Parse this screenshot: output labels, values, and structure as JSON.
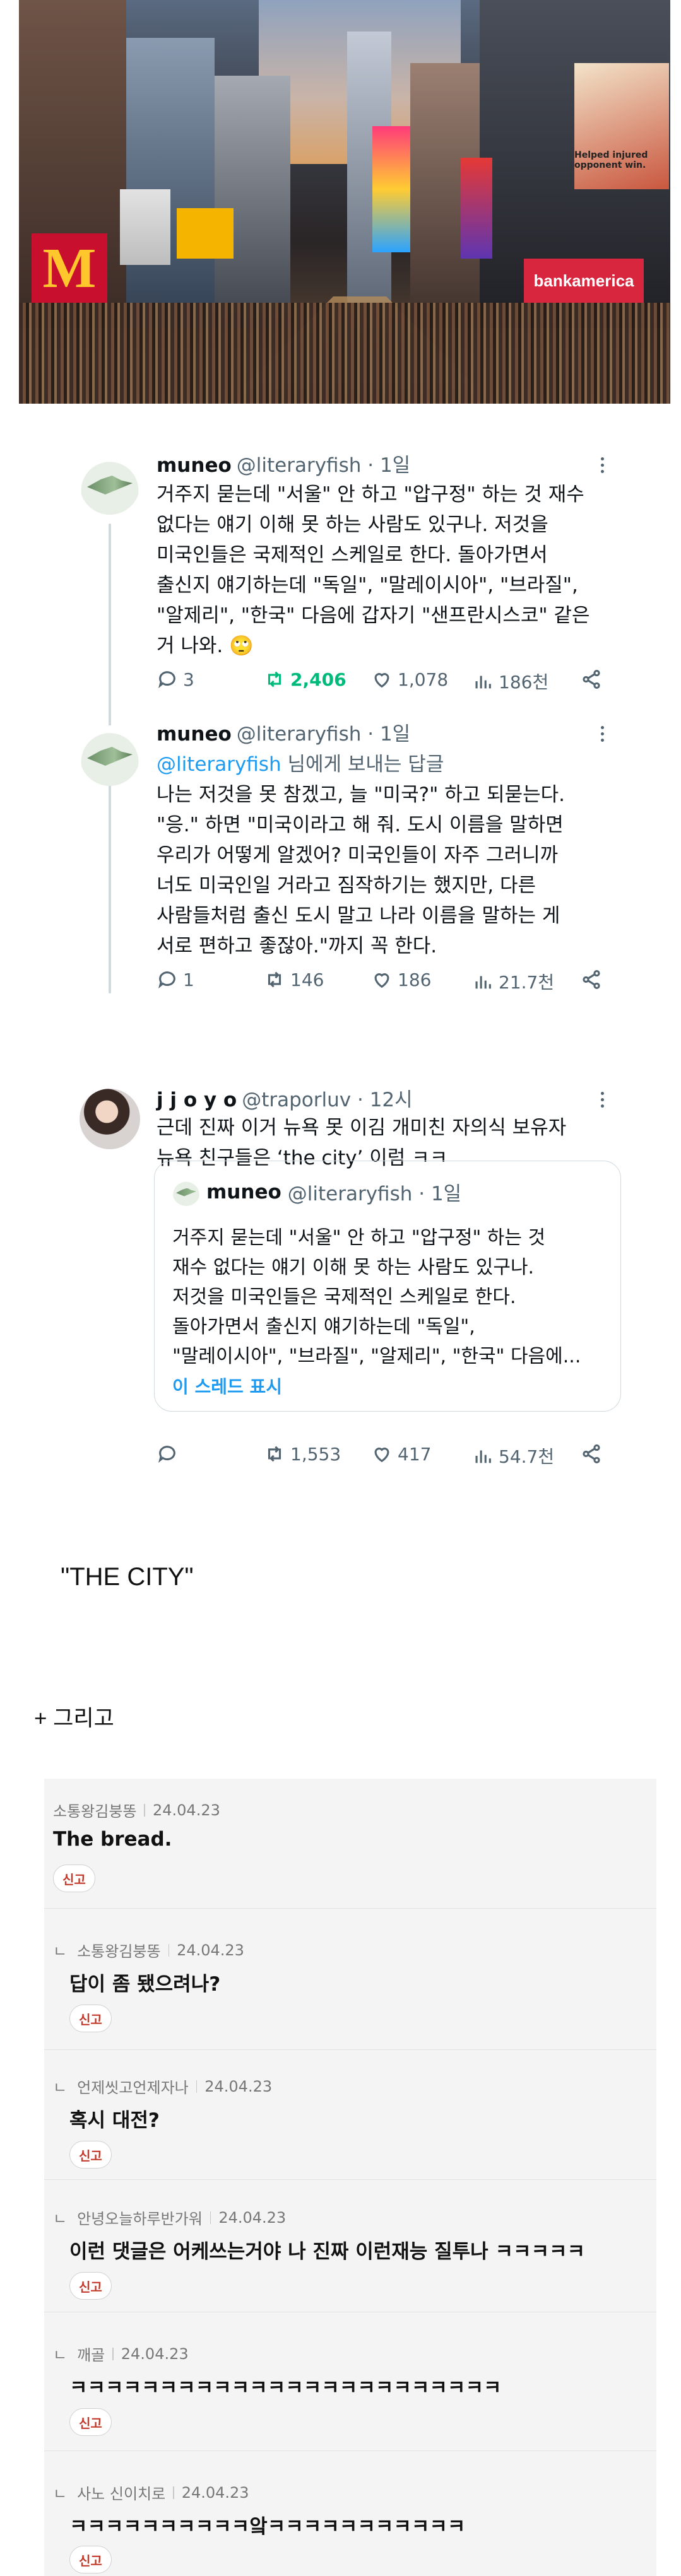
{
  "photo": {
    "mcdonalds_sign": "M",
    "store_sign": "bankamerica",
    "ad_text": "Helped injured opponent win."
  },
  "tweet1": {
    "name": "muneo",
    "handle": "@literaryfish · 1일",
    "text": "거주지 묻는데 \"서울\" 안 하고 \"압구정\" 하는 것 재수\n없다는 얘기 이해 못 하는 사람도 있구나. 저것을\n미국인들은 국제적인 스케일로 한다. 돌아가면서\n출신지 얘기하는데 \"독일\", \"말레이시아\", \"브라질\",\n\"알제리\", \"한국\" 다음에 갑자기 \"샌프란시스코\" 같은\n거 나와. 🙄",
    "replies": "3",
    "retweets": "2,406",
    "likes": "1,078",
    "views": "186천"
  },
  "tweet2": {
    "name": "muneo",
    "handle": "@literaryfish · 1일",
    "reply_mention": "@literaryfish",
    "reply_suffix": " 님에게 보내는 답글",
    "text": "나는 저것을 못 참겠고, 늘 \"미국?\" 하고 되묻는다.\n\"응.\" 하면 \"미국이라고 해 줘. 도시 이름을 말하면\n우리가 어떻게 알겠어? 미국인들이 자주 그러니까\n너도 미국인일 거라고 짐작하기는 했지만, 다른\n사람들처럼 출신 도시 말고 나라 이름을 말하는 게\n서로 편하고 좋잖아.\"까지 꼭 한다.",
    "replies": "1",
    "retweets": "146",
    "likes": "186",
    "views": "21.7천"
  },
  "tweet3": {
    "name": "j j o y o",
    "handle": "@traporluv · 12시",
    "text": "근데 진짜 이거 뉴욕 못 이김 개미친 자의식 보유자\n뉴욕 친구들은 ‘the city’ 이럼 ㅋㅋ",
    "quote": {
      "name": "muneo",
      "handle": "@literaryfish · 1일",
      "text": "거주지 묻는데 \"서울\" 안 하고 \"압구정\" 하는 것\n재수 없다는 얘기 이해 못 하는 사람도 있구나.\n저것을 미국인들은 국제적인 스케일로 한다.\n돌아가면서 출신지 얘기하는데 \"독일\",\n\"말레이시아\", \"브라질\", \"알제리\", \"한국\" 다음에...",
      "show_thread": "이 스레드 표시"
    },
    "replies": "",
    "retweets": "1,553",
    "likes": "417",
    "views": "54.7천"
  },
  "caption1": "\"THE CITY\"",
  "caption2": "+ 그리고",
  "comments": [
    {
      "author": "소통왕김붕똥",
      "date": "24.04.23",
      "text": "The bread.",
      "report": "신고"
    },
    {
      "author": "소통왕김붕똥",
      "date": "24.04.23",
      "text": "답이 좀 됐으려나?",
      "report": "신고"
    },
    {
      "author": "언제씻고언제자나",
      "date": "24.04.23",
      "text": "혹시 대전?",
      "report": "신고"
    },
    {
      "author": "안녕오늘하루반가워",
      "date": "24.04.23",
      "text": "이런 댓글은 어케쓰는거야 나 진짜 이런재능 질투나 ㅋㅋㅋㅋㅋ",
      "report": "신고"
    },
    {
      "author": "깨골",
      "date": "24.04.23",
      "text": "ㅋㅋㅋㅋㅋㅋㅋㅋㅋㅋㅋㅋㅋㅋㅋㅋㅋㅋㅋㅋㅋㅋㅋㅋ",
      "report": "신고"
    },
    {
      "author": "사노 신이치로",
      "date": "24.04.23",
      "text": "ㅋㅋㅋㅋㅋㅋㅋㅋㅋㅋ앜ㅋㅋㅋㅋㅋㅋㅋㅋㅋㅋㅋ",
      "report": "신고"
    }
  ],
  "colors": {
    "link": "#1d9bf0",
    "retweet_active": "#00ba7c",
    "muted": "#536471",
    "report": "#c0392b"
  }
}
